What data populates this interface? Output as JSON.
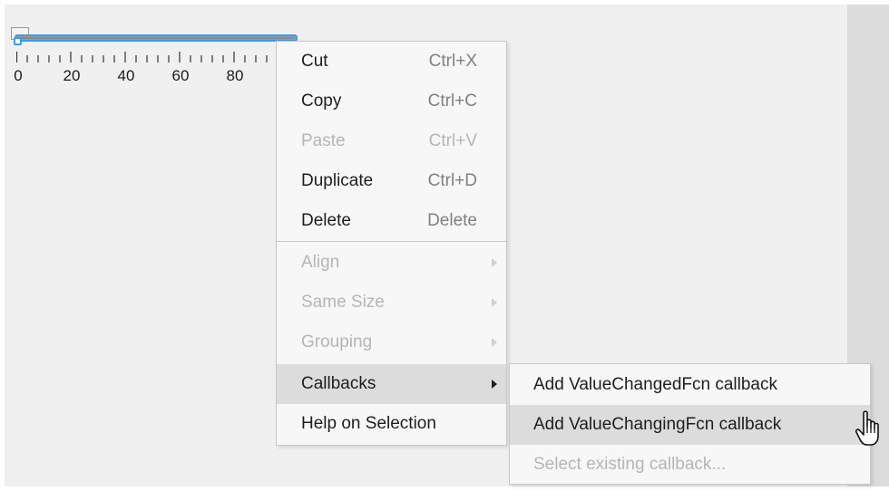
{
  "slider": {
    "value": 0,
    "limits": [
      0,
      100
    ],
    "tick_labels": [
      "0",
      "20",
      "40",
      "60",
      "80"
    ],
    "accent_color": "#3b9bea"
  },
  "context_menu": {
    "items": [
      {
        "label": "Cut",
        "shortcut": "Ctrl+X",
        "enabled": true
      },
      {
        "label": "Copy",
        "shortcut": "Ctrl+C",
        "enabled": true
      },
      {
        "label": "Paste",
        "shortcut": "Ctrl+V",
        "enabled": false
      },
      {
        "label": "Duplicate",
        "shortcut": "Ctrl+D",
        "enabled": true
      },
      {
        "label": "Delete",
        "shortcut": "Delete",
        "enabled": true
      },
      {
        "label": "Align",
        "submenu": true,
        "enabled": false
      },
      {
        "label": "Same Size",
        "submenu": true,
        "enabled": false
      },
      {
        "label": "Grouping",
        "submenu": true,
        "enabled": false
      },
      {
        "label": "Callbacks",
        "submenu": true,
        "enabled": true,
        "highlighted": true
      },
      {
        "label": "Help on Selection",
        "enabled": true
      }
    ]
  },
  "callbacks_submenu": {
    "items": [
      {
        "label": "Add ValueChangedFcn callback",
        "enabled": true
      },
      {
        "label": "Add ValueChangingFcn callback",
        "enabled": true,
        "highlighted": true
      },
      {
        "label": "Select existing callback...",
        "enabled": false
      }
    ]
  },
  "cursor": {
    "icon": "hand-pointer-icon"
  }
}
